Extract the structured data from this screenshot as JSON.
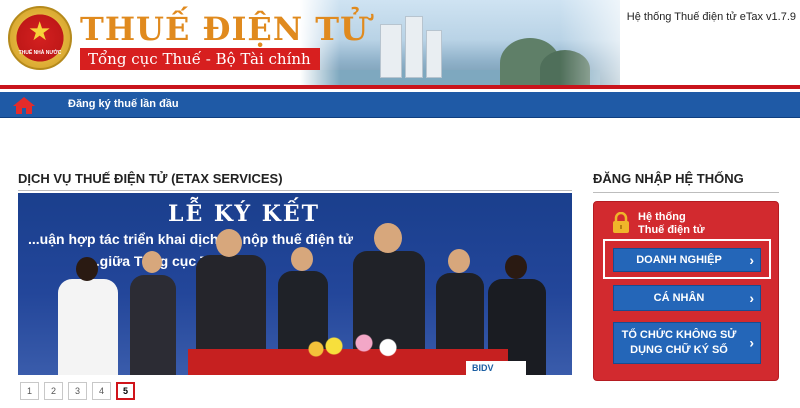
{
  "header": {
    "title": "THUẾ ĐIỆN TỬ",
    "subtitle": "Tổng cục Thuế - Bộ Tài chính",
    "emblem_text": "THUẾ NHÀ NƯỚC",
    "version_text": "Hệ thống Thuế điện tử eTax v1.7.9"
  },
  "nav": {
    "home_icon": "home-icon",
    "first_registration": "Đăng ký thuế lần đầu"
  },
  "main": {
    "section_title": "DỊCH VỤ THUẾ ĐIỆN TỬ (ETAX SERVICES)",
    "banner": {
      "title": "LỄ KÝ KẾT",
      "line1": "...uận hợp tác triển khai dịch vụ nộp thuế điện tử",
      "line2": "...giữa Tổng cục Thuế...",
      "sponsor": "BIDV"
    },
    "pager": [
      "1",
      "2",
      "3",
      "4",
      "5"
    ],
    "active_page": "5"
  },
  "login": {
    "section_title": "ĐĂNG NHẬP HỆ THỐNG",
    "system_line1": "Hệ thống",
    "system_line2": "Thuế điện tử",
    "buttons": {
      "business": "DOANH NGHIỆP",
      "individual": "CÁ NHÂN",
      "org_line1": "TỔ CHỨC KHÔNG SỬ",
      "org_line2": "DỤNG CHỮ KÝ SỐ"
    }
  },
  "colors": {
    "accent_red": "#d22a2f",
    "nav_blue": "#1f5aa6",
    "button_blue": "#2466b8",
    "title_orange": "#e08a1e"
  }
}
